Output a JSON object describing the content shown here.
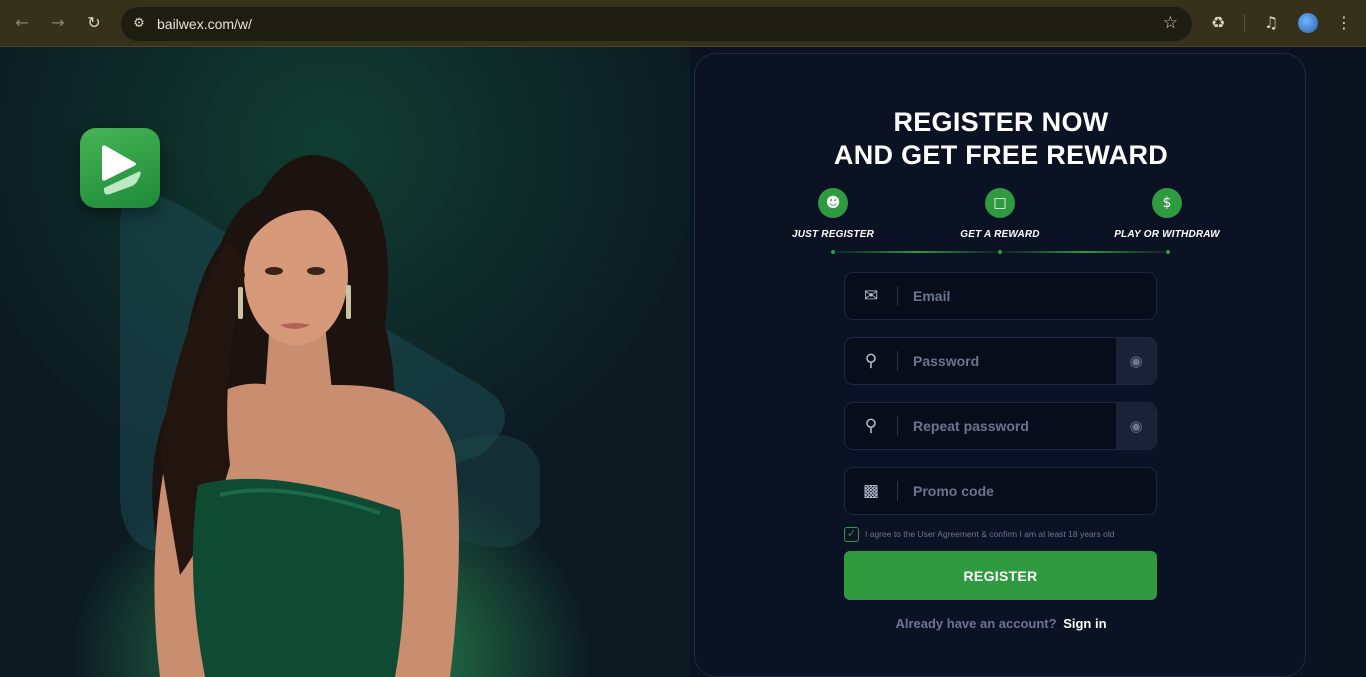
{
  "browser": {
    "url": "bailwex.com/w/",
    "icons": [
      "back-arrow-icon",
      "forward-arrow-icon",
      "reload-icon",
      "site-settings-icon",
      "bookmark-star-icon",
      "extensions-icon",
      "media-control-icon",
      "profile-avatar",
      "more-menu-icon"
    ]
  },
  "hero": {
    "logo_icon": "play-icon",
    "background_icon": "play-icon",
    "image": "model-portrait"
  },
  "form": {
    "title_line1": "REGISTER NOW",
    "title_line2": "AND GET FREE REWARD",
    "steps": [
      {
        "label": "JUST REGISTER",
        "icon": "user-icon"
      },
      {
        "label": "GET A REWARD",
        "icon": "gift-box-icon"
      },
      {
        "label": "PLAY OR WITHDRAW",
        "icon": "money-bag-icon"
      }
    ],
    "email": {
      "placeholder": "Email",
      "icon": "envelope-icon"
    },
    "password": {
      "placeholder": "Password",
      "icon": "key-icon",
      "toggle_icon": "eye-icon"
    },
    "repeat_password": {
      "placeholder": "Repeat password",
      "icon": "key-icon",
      "toggle_icon": "eye-icon"
    },
    "promo": {
      "placeholder": "Promo code",
      "icon": "gift-icon"
    },
    "agreement": "I agree to the User Agreement & confirm I am at least 18 years old",
    "agreement_checked": true,
    "register_label": "REGISTER",
    "signin_question": "Already have an account?",
    "signin_link": "Sign in"
  },
  "colors": {
    "accent": "#2f9a3f",
    "card_bg": "#0b1224",
    "page_bg": "#0b1220",
    "browser_bar": "#35311a"
  }
}
